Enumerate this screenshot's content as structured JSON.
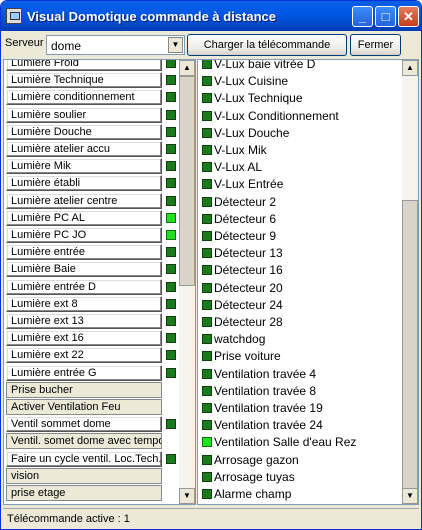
{
  "window": {
    "title": "Visual Domotique commande à distance"
  },
  "toolbar": {
    "server_label": "Serveur",
    "server_value": "dome",
    "load_label": "Charger la télécommande",
    "close_label": "Fermer"
  },
  "left_list": [
    {
      "label": "Lumière Froid",
      "state": "off"
    },
    {
      "label": "Lumière Technique",
      "state": "off"
    },
    {
      "label": "Lumière conditionnement",
      "state": "off"
    },
    {
      "label": "Lumière soulier",
      "state": "off"
    },
    {
      "label": "Lumière Douche",
      "state": "off"
    },
    {
      "label": "Lumière atelier accu",
      "state": "off"
    },
    {
      "label": "Lumière Mik",
      "state": "off"
    },
    {
      "label": "Lumière établi",
      "state": "off"
    },
    {
      "label": "Lumière atelier centre",
      "state": "off"
    },
    {
      "label": "Lumière PC AL",
      "state": "on"
    },
    {
      "label": "Lumière PC JO",
      "state": "on"
    },
    {
      "label": "Lumière entrée",
      "state": "off"
    },
    {
      "label": "Lumière Baie",
      "state": "off"
    },
    {
      "label": "Lumière entrée D",
      "state": "off"
    },
    {
      "label": "Lumière ext 8",
      "state": "off"
    },
    {
      "label": "Lumière ext 13",
      "state": "off"
    },
    {
      "label": "Lumière ext 16",
      "state": "off"
    },
    {
      "label": "Lumière ext 22",
      "state": "off"
    },
    {
      "label": "Lumière entrée G",
      "state": "off"
    },
    {
      "label": "Prise bucher",
      "state": "none"
    },
    {
      "label": "Activer Ventilation Feu",
      "state": "none"
    },
    {
      "label": "Ventil sommet dome",
      "state": "off"
    },
    {
      "label": "Ventil. somet dome avec tempo",
      "state": "none"
    },
    {
      "label": "Faire un cycle ventil. Loc.Tech.",
      "state": "off"
    },
    {
      "label": "vision",
      "state": "none"
    },
    {
      "label": "prise etage",
      "state": "none"
    }
  ],
  "right_list": [
    {
      "label": "V-Lux baie vitrée D",
      "state": "off"
    },
    {
      "label": "V-Lux Cuisine",
      "state": "off"
    },
    {
      "label": "V-Lux Technique",
      "state": "off"
    },
    {
      "label": "V-Lux Conditionnement",
      "state": "off"
    },
    {
      "label": "V-Lux Douche",
      "state": "off"
    },
    {
      "label": "V-Lux Mik",
      "state": "off"
    },
    {
      "label": "V-Lux AL",
      "state": "off"
    },
    {
      "label": "V-Lux Entrée",
      "state": "off"
    },
    {
      "label": "Détecteur 2",
      "state": "off"
    },
    {
      "label": "Détecteur 6",
      "state": "off"
    },
    {
      "label": "Détecteur 9",
      "state": "off"
    },
    {
      "label": "Détecteur 13",
      "state": "off"
    },
    {
      "label": "Détecteur 16",
      "state": "off"
    },
    {
      "label": "Détecteur 20",
      "state": "off"
    },
    {
      "label": "Détecteur 24",
      "state": "off"
    },
    {
      "label": "Détecteur 28",
      "state": "off"
    },
    {
      "label": "watchdog",
      "state": "off"
    },
    {
      "label": "Prise voiture",
      "state": "off"
    },
    {
      "label": "Ventilation travée 4",
      "state": "off"
    },
    {
      "label": "Ventilation travée 8",
      "state": "off"
    },
    {
      "label": "Ventilation travée 19",
      "state": "off"
    },
    {
      "label": "Ventilation travée 24",
      "state": "off"
    },
    {
      "label": "Ventilation Salle d'eau Rez",
      "state": "on"
    },
    {
      "label": "Arrosage gazon",
      "state": "off"
    },
    {
      "label": "Arrosage tuyas",
      "state": "off"
    },
    {
      "label": "Alarme champ",
      "state": "off"
    }
  ],
  "status": {
    "text": "Télécommande active : 1"
  }
}
